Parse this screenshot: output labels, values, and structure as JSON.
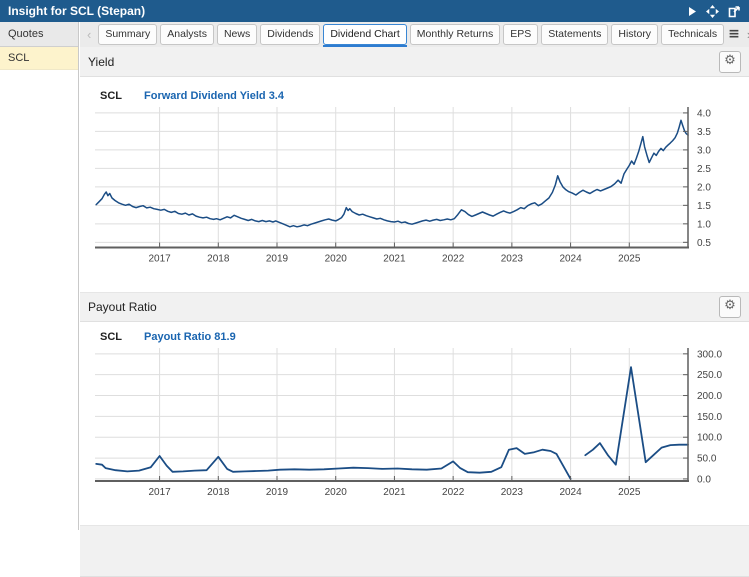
{
  "titlebar": {
    "title": "Insight for SCL (Stepan)",
    "icons": [
      "play-icon",
      "expand-icon",
      "popout-icon"
    ]
  },
  "icons": {
    "gear_glyph": "⚙",
    "menu_glyph": "≡",
    "prev_glyph": "‹",
    "next_glyph": "›"
  },
  "sidebar": {
    "header": "Quotes",
    "items": [
      {
        "label": "SCL",
        "selected": true
      }
    ]
  },
  "tabbar": {
    "tabs": [
      {
        "label": "Summary",
        "selected": false
      },
      {
        "label": "Analysts",
        "selected": false
      },
      {
        "label": "News",
        "selected": false
      },
      {
        "label": "Dividends",
        "selected": false
      },
      {
        "label": "Dividend Chart",
        "selected": true
      },
      {
        "label": "Monthly Returns",
        "selected": false
      },
      {
        "label": "EPS",
        "selected": false
      },
      {
        "label": "Statements",
        "selected": false
      },
      {
        "label": "History",
        "selected": false
      },
      {
        "label": "Technicals",
        "selected": false
      }
    ]
  },
  "sections": [
    {
      "title": "Yield"
    },
    {
      "title": "Payout Ratio"
    }
  ],
  "chart_data": [
    {
      "type": "line",
      "section": "Yield",
      "symbol": "SCL",
      "series_name": "Forward Dividend Yield",
      "current_value": 3.4,
      "series_label": "Forward Dividend Yield 3.4",
      "color": "#1b4d85",
      "line_width": 1.5,
      "grid": true,
      "axis_position": "right",
      "xlim": [
        2015.9,
        2026.0
      ],
      "ylim": [
        0.36,
        4.16
      ],
      "x_tick_values": [
        2017,
        2018,
        2019,
        2020,
        2021,
        2022,
        2023,
        2024,
        2025
      ],
      "x_tick_labels": [
        "2017",
        "2018",
        "2019",
        "2020",
        "2021",
        "2022",
        "2023",
        "2024",
        "2025"
      ],
      "y_tick_values": [
        4.0,
        3.5,
        3.0,
        2.5,
        2.0,
        1.5,
        1.0,
        0.5
      ],
      "y_tick_labels": [
        "4.0",
        "3.5",
        "3.0",
        "2.5",
        "2.0",
        "1.5",
        "1.0",
        "0.5"
      ],
      "segments": [
        [
          [
            2015.92,
            1.52
          ],
          [
            2015.97,
            1.6
          ],
          [
            2016.02,
            1.68
          ],
          [
            2016.06,
            1.8
          ],
          [
            2016.09,
            1.86
          ],
          [
            2016.12,
            1.76
          ],
          [
            2016.15,
            1.82
          ],
          [
            2016.19,
            1.7
          ],
          [
            2016.24,
            1.63
          ],
          [
            2016.3,
            1.57
          ],
          [
            2016.36,
            1.53
          ],
          [
            2016.42,
            1.5
          ],
          [
            2016.48,
            1.53
          ],
          [
            2016.54,
            1.47
          ],
          [
            2016.6,
            1.44
          ],
          [
            2016.66,
            1.47
          ],
          [
            2016.72,
            1.49
          ],
          [
            2016.78,
            1.43
          ],
          [
            2016.84,
            1.45
          ],
          [
            2016.9,
            1.41
          ],
          [
            2016.96,
            1.39
          ],
          [
            2017.02,
            1.37
          ],
          [
            2017.08,
            1.39
          ],
          [
            2017.14,
            1.34
          ],
          [
            2017.2,
            1.31
          ],
          [
            2017.26,
            1.34
          ],
          [
            2017.32,
            1.28
          ],
          [
            2017.38,
            1.26
          ],
          [
            2017.44,
            1.29
          ],
          [
            2017.5,
            1.24
          ],
          [
            2017.56,
            1.27
          ],
          [
            2017.62,
            1.21
          ],
          [
            2017.68,
            1.18
          ],
          [
            2017.74,
            1.16
          ],
          [
            2017.8,
            1.18
          ],
          [
            2017.86,
            1.14
          ],
          [
            2017.92,
            1.12
          ],
          [
            2017.97,
            1.14
          ],
          [
            2018.03,
            1.11
          ],
          [
            2018.09,
            1.15
          ],
          [
            2018.15,
            1.19
          ],
          [
            2018.21,
            1.16
          ],
          [
            2018.27,
            1.23
          ],
          [
            2018.33,
            1.19
          ],
          [
            2018.39,
            1.15
          ],
          [
            2018.45,
            1.12
          ],
          [
            2018.51,
            1.09
          ],
          [
            2018.57,
            1.12
          ],
          [
            2018.63,
            1.08
          ],
          [
            2018.69,
            1.06
          ],
          [
            2018.75,
            1.09
          ],
          [
            2018.81,
            1.06
          ],
          [
            2018.87,
            1.08
          ],
          [
            2018.93,
            1.05
          ],
          [
            2018.98,
            1.08
          ],
          [
            2019.04,
            1.04
          ],
          [
            2019.1,
            1.0
          ],
          [
            2019.16,
            0.96
          ],
          [
            2019.22,
            0.92
          ],
          [
            2019.28,
            0.95
          ],
          [
            2019.34,
            0.92
          ],
          [
            2019.4,
            0.94
          ],
          [
            2019.46,
            0.97
          ],
          [
            2019.52,
            0.95
          ],
          [
            2019.58,
            0.99
          ],
          [
            2019.64,
            1.02
          ],
          [
            2019.7,
            1.05
          ],
          [
            2019.76,
            1.08
          ],
          [
            2019.82,
            1.11
          ],
          [
            2019.88,
            1.13
          ],
          [
            2019.94,
            1.1
          ],
          [
            2020.0,
            1.08
          ],
          [
            2020.05,
            1.12
          ],
          [
            2020.1,
            1.17
          ],
          [
            2020.14,
            1.26
          ],
          [
            2020.18,
            1.44
          ],
          [
            2020.21,
            1.36
          ],
          [
            2020.24,
            1.41
          ],
          [
            2020.28,
            1.33
          ],
          [
            2020.34,
            1.28
          ],
          [
            2020.4,
            1.24
          ],
          [
            2020.46,
            1.26
          ],
          [
            2020.52,
            1.22
          ],
          [
            2020.58,
            1.19
          ],
          [
            2020.64,
            1.16
          ],
          [
            2020.7,
            1.13
          ],
          [
            2020.76,
            1.15
          ],
          [
            2020.82,
            1.11
          ],
          [
            2020.88,
            1.08
          ],
          [
            2020.94,
            1.06
          ],
          [
            2021.0,
            1.05
          ],
          [
            2021.06,
            1.07
          ],
          [
            2021.12,
            1.03
          ],
          [
            2021.18,
            1.05
          ],
          [
            2021.24,
            1.01
          ],
          [
            2021.3,
            0.99
          ],
          [
            2021.36,
            1.02
          ],
          [
            2021.42,
            1.05
          ],
          [
            2021.48,
            1.08
          ],
          [
            2021.54,
            1.1
          ],
          [
            2021.6,
            1.07
          ],
          [
            2021.66,
            1.1
          ],
          [
            2021.72,
            1.12
          ],
          [
            2021.78,
            1.09
          ],
          [
            2021.84,
            1.11
          ],
          [
            2021.9,
            1.13
          ],
          [
            2021.96,
            1.11
          ],
          [
            2022.02,
            1.14
          ],
          [
            2022.08,
            1.25
          ],
          [
            2022.14,
            1.38
          ],
          [
            2022.2,
            1.33
          ],
          [
            2022.26,
            1.25
          ],
          [
            2022.32,
            1.2
          ],
          [
            2022.38,
            1.24
          ],
          [
            2022.44,
            1.28
          ],
          [
            2022.5,
            1.32
          ],
          [
            2022.56,
            1.28
          ],
          [
            2022.62,
            1.24
          ],
          [
            2022.68,
            1.21
          ],
          [
            2022.74,
            1.26
          ],
          [
            2022.8,
            1.31
          ],
          [
            2022.86,
            1.35
          ],
          [
            2022.92,
            1.31
          ],
          [
            2022.97,
            1.29
          ],
          [
            2023.03,
            1.33
          ],
          [
            2023.09,
            1.38
          ],
          [
            2023.15,
            1.44
          ],
          [
            2023.21,
            1.41
          ],
          [
            2023.27,
            1.49
          ],
          [
            2023.33,
            1.54
          ],
          [
            2023.39,
            1.57
          ],
          [
            2023.45,
            1.49
          ],
          [
            2023.51,
            1.54
          ],
          [
            2023.57,
            1.62
          ],
          [
            2023.63,
            1.7
          ],
          [
            2023.69,
            1.85
          ],
          [
            2023.74,
            2.05
          ],
          [
            2023.78,
            2.3
          ],
          [
            2023.82,
            2.14
          ],
          [
            2023.87,
            2.0
          ],
          [
            2023.92,
            1.92
          ],
          [
            2023.97,
            1.87
          ],
          [
            2024.03,
            1.83
          ],
          [
            2024.09,
            1.78
          ],
          [
            2024.15,
            1.85
          ],
          [
            2024.21,
            1.91
          ],
          [
            2024.27,
            1.86
          ],
          [
            2024.33,
            1.82
          ],
          [
            2024.39,
            1.88
          ],
          [
            2024.45,
            1.93
          ],
          [
            2024.51,
            1.89
          ],
          [
            2024.57,
            1.93
          ],
          [
            2024.63,
            1.97
          ],
          [
            2024.69,
            2.01
          ],
          [
            2024.75,
            2.08
          ],
          [
            2024.81,
            2.18
          ],
          [
            2024.86,
            2.1
          ],
          [
            2024.91,
            2.35
          ],
          [
            2024.96,
            2.48
          ],
          [
            2025.0,
            2.58
          ],
          [
            2025.04,
            2.7
          ],
          [
            2025.08,
            2.61
          ],
          [
            2025.12,
            2.77
          ],
          [
            2025.16,
            2.96
          ],
          [
            2025.2,
            3.18
          ],
          [
            2025.23,
            3.36
          ],
          [
            2025.26,
            3.08
          ],
          [
            2025.3,
            2.86
          ],
          [
            2025.34,
            2.66
          ],
          [
            2025.38,
            2.79
          ],
          [
            2025.42,
            2.91
          ],
          [
            2025.46,
            2.85
          ],
          [
            2025.5,
            2.96
          ],
          [
            2025.54,
            3.04
          ],
          [
            2025.58,
            2.98
          ],
          [
            2025.62,
            3.07
          ],
          [
            2025.66,
            3.13
          ],
          [
            2025.7,
            3.19
          ],
          [
            2025.74,
            3.25
          ],
          [
            2025.78,
            3.33
          ],
          [
            2025.82,
            3.46
          ],
          [
            2025.85,
            3.62
          ],
          [
            2025.88,
            3.8
          ],
          [
            2025.91,
            3.66
          ],
          [
            2025.94,
            3.52
          ],
          [
            2025.97,
            3.44
          ],
          [
            2026.0,
            3.4
          ]
        ]
      ]
    },
    {
      "type": "line",
      "section": "Payout Ratio",
      "symbol": "SCL",
      "series_name": "Payout Ratio",
      "current_value": 81.9,
      "series_label": "Payout Ratio 81.9",
      "color": "#1b4d85",
      "line_width": 1.8,
      "grid": true,
      "axis_position": "right",
      "xlim": [
        2015.9,
        2026.0
      ],
      "ylim": [
        -5,
        314
      ],
      "x_tick_values": [
        2017,
        2018,
        2019,
        2020,
        2021,
        2022,
        2023,
        2024,
        2025
      ],
      "x_tick_labels": [
        "2017",
        "2018",
        "2019",
        "2020",
        "2021",
        "2022",
        "2023",
        "2024",
        "2025"
      ],
      "y_tick_values": [
        300,
        250,
        200,
        150,
        100,
        50,
        0
      ],
      "y_tick_labels": [
        "300.0",
        "250.0",
        "200.0",
        "150.0",
        "100.0",
        "50.0",
        "0.0"
      ],
      "segments": [
        [
          [
            2015.92,
            36
          ],
          [
            2016.02,
            34
          ],
          [
            2016.08,
            26
          ],
          [
            2016.25,
            21
          ],
          [
            2016.45,
            18
          ],
          [
            2016.65,
            20
          ],
          [
            2016.85,
            28
          ],
          [
            2017.0,
            55
          ],
          [
            2017.12,
            32
          ],
          [
            2017.22,
            17
          ],
          [
            2017.4,
            18
          ],
          [
            2017.6,
            20
          ],
          [
            2017.8,
            21
          ],
          [
            2018.0,
            53
          ],
          [
            2018.15,
            24
          ],
          [
            2018.25,
            17
          ],
          [
            2018.45,
            18
          ],
          [
            2018.65,
            19
          ],
          [
            2018.85,
            20
          ],
          [
            2019.05,
            22
          ],
          [
            2019.3,
            23
          ],
          [
            2019.55,
            22
          ],
          [
            2019.8,
            23
          ],
          [
            2020.05,
            25
          ],
          [
            2020.3,
            27
          ],
          [
            2020.55,
            26
          ],
          [
            2020.8,
            24
          ],
          [
            2021.05,
            25
          ],
          [
            2021.3,
            23
          ],
          [
            2021.55,
            22
          ],
          [
            2021.8,
            25
          ],
          [
            2022.0,
            42
          ],
          [
            2022.12,
            26
          ],
          [
            2022.25,
            16
          ],
          [
            2022.45,
            15
          ],
          [
            2022.65,
            17
          ],
          [
            2022.82,
            28
          ],
          [
            2022.95,
            70
          ],
          [
            2023.08,
            74
          ],
          [
            2023.22,
            60
          ],
          [
            2023.38,
            64
          ],
          [
            2023.52,
            70
          ],
          [
            2023.66,
            67
          ],
          [
            2023.76,
            60
          ],
          [
            2024.0,
            0
          ]
        ],
        [
          [
            2024.25,
            57
          ],
          [
            2024.38,
            70
          ],
          [
            2024.5,
            86
          ],
          [
            2024.64,
            56
          ],
          [
            2024.77,
            34
          ],
          [
            2025.03,
            268
          ],
          [
            2025.28,
            40
          ],
          [
            2025.42,
            58
          ],
          [
            2025.55,
            75
          ],
          [
            2025.7,
            81
          ],
          [
            2025.85,
            82
          ],
          [
            2026.0,
            82
          ]
        ]
      ]
    }
  ]
}
